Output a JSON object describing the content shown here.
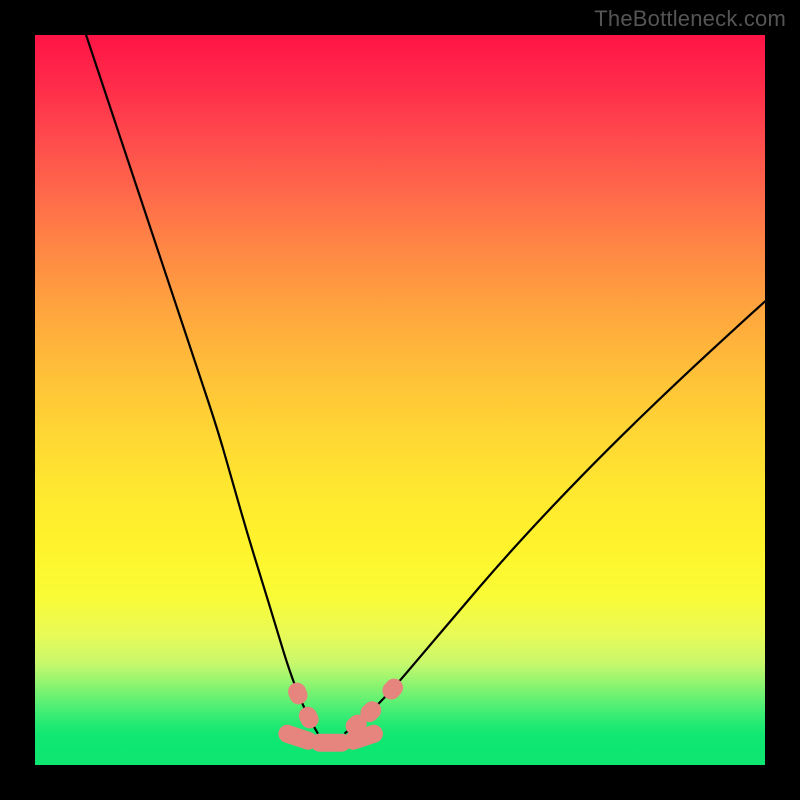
{
  "watermark": "TheBottleneck.com",
  "colors": {
    "background": "#000000",
    "gradient_top": "#ff1446",
    "gradient_mid": "#ffe730",
    "gradient_bottom": "#0de671",
    "curve": "#000000",
    "marker": "#e6857d"
  },
  "chart_data": {
    "type": "line",
    "title": "",
    "xlabel": "",
    "ylabel": "",
    "xlim": [
      0,
      100
    ],
    "ylim": [
      0,
      100
    ],
    "grid": false,
    "legend": null,
    "series": [
      {
        "name": "left-curve",
        "x": [
          7,
          10,
          13,
          16,
          19,
          22,
          25,
          27,
          29,
          31,
          33,
          34.5,
          36,
          37.5,
          38.7
        ],
        "y": [
          100,
          91,
          82,
          73,
          64,
          55,
          46,
          39,
          32,
          25.5,
          19,
          14,
          9.8,
          6.5,
          4.4
        ]
      },
      {
        "name": "right-curve",
        "x": [
          42.5,
          44,
          46,
          49,
          53,
          58,
          64,
          71,
          79,
          88,
          97,
          100
        ],
        "y": [
          4.4,
          5.5,
          7.3,
          10.4,
          15.1,
          21,
          28,
          35.6,
          43.8,
          52.5,
          60.8,
          63.5
        ]
      },
      {
        "name": "valley-floor",
        "x": [
          36,
          37.5,
          39,
          40.5,
          42,
          43.5,
          45
        ],
        "y": [
          3.8,
          3.3,
          3.1,
          3.05,
          3.1,
          3.3,
          3.8
        ]
      }
    ],
    "markers": [
      {
        "along": "left-curve",
        "x": 36.0,
        "y": 9.8
      },
      {
        "along": "left-curve",
        "x": 37.5,
        "y": 6.5
      },
      {
        "along": "valley-floor",
        "x": 36.0,
        "y": 3.8,
        "long": true
      },
      {
        "along": "valley-floor",
        "x": 40.5,
        "y": 3.05,
        "long": true
      },
      {
        "along": "valley-floor",
        "x": 45.0,
        "y": 3.8,
        "long": true
      },
      {
        "along": "right-curve",
        "x": 44.0,
        "y": 5.5
      },
      {
        "along": "right-curve",
        "x": 46.0,
        "y": 7.3
      },
      {
        "along": "right-curve",
        "x": 49.0,
        "y": 10.4
      }
    ]
  }
}
